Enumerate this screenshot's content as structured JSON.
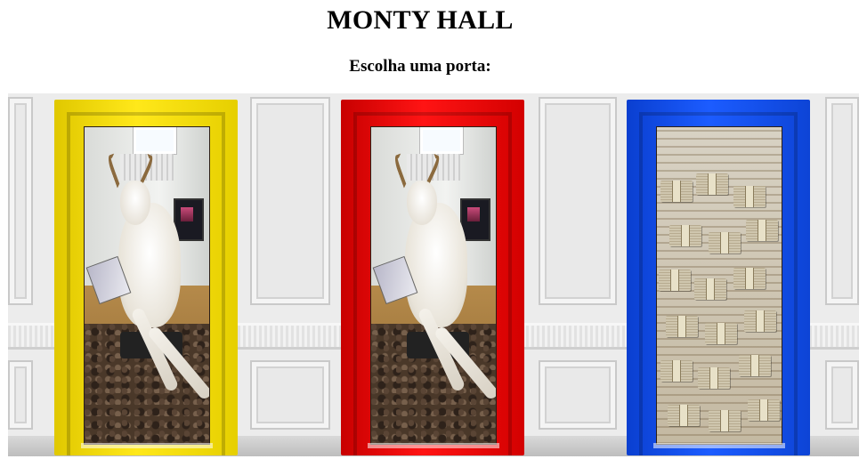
{
  "header": {
    "title": "MONTY HALL",
    "subtitle": "Escolha uma porta:"
  },
  "doors": [
    {
      "color": "#f5dc00",
      "content": "goat"
    },
    {
      "color": "#f00000",
      "content": "goat"
    },
    {
      "color": "#1550f0",
      "content": "money"
    }
  ]
}
